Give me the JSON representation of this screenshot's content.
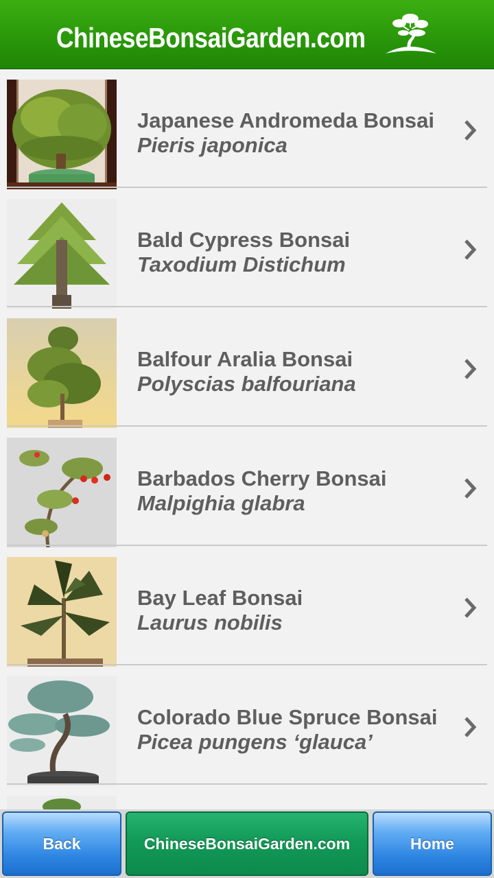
{
  "header": {
    "title": "ChineseBonsaiGarden.com",
    "logo_icon": "bonsai-tree-icon"
  },
  "items": [
    {
      "name": "Japanese Andromeda Bonsai",
      "latin": "Pieris japonica"
    },
    {
      "name": "Bald Cypress Bonsai",
      "latin": "Taxodium Distichum"
    },
    {
      "name": "Balfour Aralia Bonsai",
      "latin": "Polyscias balfouriana"
    },
    {
      "name": "Barbados Cherry Bonsai",
      "latin": "Malpighia glabra"
    },
    {
      "name": "Bay Leaf Bonsai",
      "latin": "Laurus nobilis"
    },
    {
      "name": "Colorado Blue Spruce Bonsai",
      "latin": "Picea pungens ‘glauca’"
    }
  ],
  "footer": {
    "back_label": "Back",
    "site_label": "ChineseBonsaiGarden.com",
    "home_label": "Home"
  },
  "colors": {
    "header_green": "#2a980a",
    "text_gray": "#5e5e5e",
    "button_blue": "#2f86e2",
    "button_green": "#129a58"
  }
}
